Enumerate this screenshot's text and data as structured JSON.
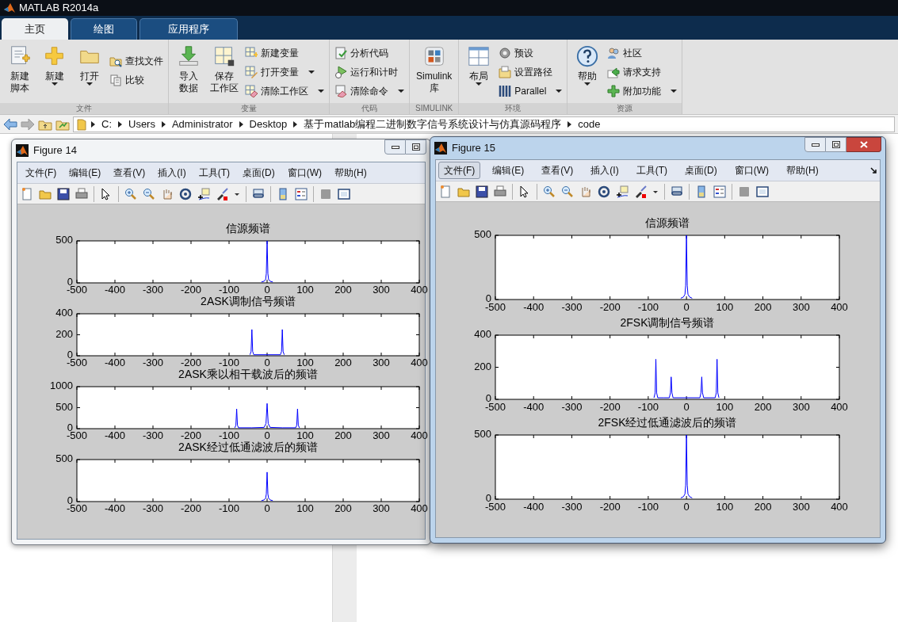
{
  "window": {
    "title": "MATLAB R2014a"
  },
  "tabs": [
    {
      "label": "主页",
      "selected": true
    },
    {
      "label": "绘图",
      "selected": false
    },
    {
      "label": "应用程序",
      "selected": false
    }
  ],
  "ribbon": {
    "groups": [
      {
        "label": "文件",
        "buttons": [
          {
            "kind": "large",
            "lines": [
              "新建",
              "脚本"
            ],
            "dropdown": false
          },
          {
            "kind": "large",
            "lines": [
              "新建"
            ],
            "dropdown": true
          },
          {
            "kind": "large",
            "lines": [
              "打开"
            ],
            "dropdown": true
          },
          {
            "kind": "small",
            "lines": [
              "查找文件"
            ],
            "dropdown": false
          },
          {
            "kind": "small",
            "lines": [
              "比较"
            ],
            "dropdown": false
          }
        ]
      },
      {
        "label": "变量",
        "buttons": [
          {
            "kind": "large",
            "lines": [
              "导入",
              "数据"
            ],
            "dropdown": false
          },
          {
            "kind": "large",
            "lines": [
              "保存",
              "工作区"
            ],
            "dropdown": false
          },
          {
            "kind": "small",
            "lines": [
              "新建变量"
            ],
            "dropdown": false
          },
          {
            "kind": "small",
            "lines": [
              "打开变量"
            ],
            "dropdown": true
          },
          {
            "kind": "small",
            "lines": [
              "清除工作区"
            ],
            "dropdown": true
          }
        ]
      },
      {
        "label": "代码",
        "buttons": [
          {
            "kind": "small",
            "lines": [
              "分析代码"
            ],
            "dropdown": false
          },
          {
            "kind": "small",
            "lines": [
              "运行和计时"
            ],
            "dropdown": false
          },
          {
            "kind": "small",
            "lines": [
              "清除命令"
            ],
            "dropdown": true
          }
        ]
      },
      {
        "label": "SIMULINK",
        "buttons": [
          {
            "kind": "large",
            "lines": [
              "Simulink",
              "库"
            ],
            "dropdown": false
          }
        ]
      },
      {
        "label": "环境",
        "buttons": [
          {
            "kind": "large",
            "lines": [
              "布局"
            ],
            "dropdown": true
          },
          {
            "kind": "small",
            "lines": [
              "预设"
            ],
            "dropdown": false
          },
          {
            "kind": "small",
            "lines": [
              "设置路径"
            ],
            "dropdown": false
          },
          {
            "kind": "small",
            "lines": [
              "Parallel"
            ],
            "dropdown": true
          }
        ]
      },
      {
        "label": "资源",
        "buttons": [
          {
            "kind": "large",
            "lines": [
              "帮助"
            ],
            "dropdown": true
          },
          {
            "kind": "small",
            "lines": [
              "社区"
            ],
            "dropdown": false
          },
          {
            "kind": "small",
            "lines": [
              "请求支持"
            ],
            "dropdown": false
          },
          {
            "kind": "small",
            "lines": [
              "附加功能"
            ],
            "dropdown": true
          }
        ]
      }
    ]
  },
  "address_bar": {
    "path": [
      "C:",
      "Users",
      "Administrator",
      "Desktop",
      "基于matlab编程二进制数字信号系统设计与仿真源码程序",
      "code"
    ]
  },
  "figures": [
    {
      "title": "Figure 14",
      "active": false,
      "controls": [
        {
          "kind": "minimize"
        },
        {
          "kind": "maximize"
        }
      ],
      "menu": [
        {
          "label": "文件(F)",
          "selected": false
        },
        {
          "label": "编辑(E)",
          "selected": false
        },
        {
          "label": "查看(V)",
          "selected": false
        },
        {
          "label": "插入(I)",
          "selected": false
        },
        {
          "label": "工具(T)",
          "selected": false
        },
        {
          "label": "桌面(D)",
          "selected": false
        },
        {
          "label": "窗口(W)",
          "selected": false
        },
        {
          "label": "帮助(H)",
          "selected": false
        }
      ],
      "plots": [
        {
          "chart_data": {
            "type": "line",
            "title": "信源频谱",
            "x": [
              -15,
              -8,
              -4,
              -2,
              0,
              2,
              4,
              8,
              15
            ],
            "series": [
              {
                "color": "#0000ff",
                "values": [
                  10,
                  20,
                  40,
                  110,
                  500,
                  110,
                  40,
                  20,
                  10
                ]
              }
            ],
            "xlim": [
              -500,
              400
            ],
            "ylim": [
              0,
              500
            ],
            "xticks": [
              -500,
              -400,
              -300,
              -200,
              -100,
              0,
              100,
              200,
              300,
              400
            ],
            "yticks": [
              0,
              500
            ]
          }
        },
        {
          "chart_data": {
            "type": "line",
            "title": "2ASK调制信号频谱",
            "x": [
              -45,
              -42,
              -40,
              -38,
              -35,
              0,
              35,
              38,
              40,
              42,
              45
            ],
            "series": [
              {
                "color": "#0000ff",
                "values": [
                  10,
                  40,
                  250,
                  40,
                  10,
                  10,
                  10,
                  40,
                  250,
                  40,
                  10
                ]
              }
            ],
            "xlim": [
              -500,
              400
            ],
            "ylim": [
              0,
              400
            ],
            "xticks": [
              -500,
              -400,
              -300,
              -200,
              -100,
              0,
              100,
              200,
              300,
              400
            ],
            "yticks": [
              0,
              200,
              400
            ]
          }
        },
        {
          "chart_data": {
            "type": "line",
            "title": "2ASK乘以相干载波后的频谱",
            "x": [
              -85,
              -82,
              -80,
              -78,
              -75,
              -40,
              -8,
              -3,
              0,
              3,
              8,
              40,
              75,
              78,
              80,
              82,
              85
            ],
            "series": [
              {
                "color": "#0000ff",
                "values": [
                  20,
                  80,
                  470,
                  80,
                  20,
                  20,
                  30,
                  120,
                  600,
                  120,
                  30,
                  20,
                  20,
                  80,
                  470,
                  80,
                  20
                ]
              }
            ],
            "xlim": [
              -500,
              400
            ],
            "ylim": [
              0,
              1000
            ],
            "xticks": [
              -500,
              -400,
              -300,
              -200,
              -100,
              0,
              100,
              200,
              300,
              400
            ],
            "yticks": [
              0,
              500,
              1000
            ]
          }
        },
        {
          "chart_data": {
            "type": "line",
            "title": "2ASK经过低通滤波后的频谱",
            "x": [
              -15,
              -8,
              -4,
              -2,
              0,
              2,
              4,
              8,
              15
            ],
            "series": [
              {
                "color": "#0000ff",
                "values": [
                  10,
                  20,
                  40,
                  90,
                  350,
                  90,
                  40,
                  20,
                  10
                ]
              }
            ],
            "xlim": [
              -500,
              400
            ],
            "ylim": [
              0,
              500
            ],
            "xticks": [
              -500,
              -400,
              -300,
              -200,
              -100,
              0,
              100,
              200,
              300,
              400
            ],
            "yticks": [
              0,
              500
            ]
          }
        }
      ]
    },
    {
      "title": "Figure 15",
      "active": true,
      "controls": [
        {
          "kind": "minimize"
        },
        {
          "kind": "maximize"
        },
        {
          "kind": "close"
        }
      ],
      "menu": [
        {
          "label": "文件(F)",
          "selected": true
        },
        {
          "label": "编辑(E)",
          "selected": false
        },
        {
          "label": "查看(V)",
          "selected": false
        },
        {
          "label": "插入(I)",
          "selected": false
        },
        {
          "label": "工具(T)",
          "selected": false
        },
        {
          "label": "桌面(D)",
          "selected": false
        },
        {
          "label": "窗口(W)",
          "selected": false
        },
        {
          "label": "帮助(H)",
          "selected": false
        }
      ],
      "plots": [
        {
          "chart_data": {
            "type": "line",
            "title": "信源频谱",
            "x": [
              -15,
              -8,
              -4,
              -2,
              0,
              2,
              4,
              8,
              15
            ],
            "series": [
              {
                "color": "#0000ff",
                "values": [
                  10,
                  20,
                  40,
                  110,
                  500,
                  110,
                  40,
                  20,
                  10
                ]
              }
            ],
            "xlim": [
              -500,
              400
            ],
            "ylim": [
              0,
              500
            ],
            "xticks": [
              -500,
              -400,
              -300,
              -200,
              -100,
              0,
              100,
              200,
              300,
              400
            ],
            "yticks": [
              0,
              500
            ]
          }
        },
        {
          "chart_data": {
            "type": "line",
            "title": "2FSK调制信号频谱",
            "x": [
              -85,
              -82,
              -80,
              -78,
              -75,
              -60,
              -45,
              -42,
              -40,
              -38,
              -35,
              0,
              35,
              38,
              40,
              42,
              45,
              60,
              75,
              78,
              80,
              82,
              85
            ],
            "series": [
              {
                "color": "#0000ff",
                "values": [
                  10,
                  40,
                  250,
                  40,
                  10,
                  10,
                  10,
                  40,
                  140,
                  40,
                  10,
                  10,
                  10,
                  40,
                  140,
                  40,
                  10,
                  10,
                  10,
                  40,
                  250,
                  40,
                  10
                ]
              }
            ],
            "xlim": [
              -500,
              400
            ],
            "ylim": [
              0,
              400
            ],
            "xticks": [
              -500,
              -400,
              -300,
              -200,
              -100,
              0,
              100,
              200,
              300,
              400
            ],
            "yticks": [
              0,
              200,
              400
            ]
          }
        },
        {
          "chart_data": {
            "type": "line",
            "title": "2FSK经过低通滤波后的频谱",
            "x": [
              -15,
              -8,
              -4,
              -2,
              0,
              2,
              4,
              8,
              15
            ],
            "series": [
              {
                "color": "#0000ff",
                "values": [
                  10,
                  20,
                  40,
                  110,
                  500,
                  110,
                  40,
                  20,
                  10
                ]
              }
            ],
            "xlim": [
              -500,
              400
            ],
            "ylim": [
              0,
              500
            ],
            "xticks": [
              -500,
              -400,
              -300,
              -200,
              -100,
              0,
              100,
              200,
              300,
              400
            ],
            "yticks": [
              0,
              500
            ]
          }
        }
      ]
    }
  ]
}
